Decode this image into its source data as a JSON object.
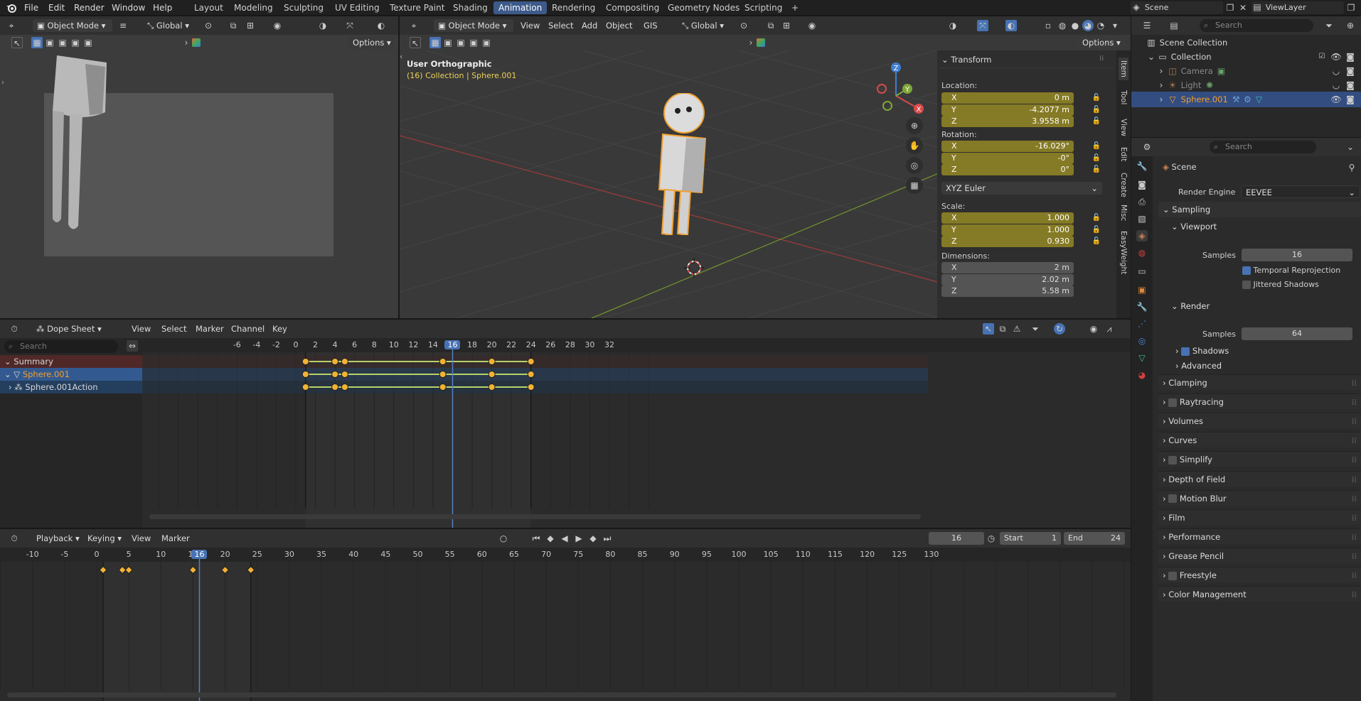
{
  "topmenu": [
    "File",
    "Edit",
    "Render",
    "Window",
    "Help"
  ],
  "workspaces": [
    "Layout",
    "Modeling",
    "Sculpting",
    "UV Editing",
    "Texture Paint",
    "Shading",
    "Animation",
    "Rendering",
    "Compositing",
    "Geometry Nodes",
    "Scripting"
  ],
  "active_workspace": "Animation",
  "scene_name": "Scene",
  "view_layer": "ViewLayer",
  "left_view": {
    "mode": "Object Mode",
    "orientation": "Global",
    "options": "Options"
  },
  "main_view": {
    "mode": "Object Mode",
    "menus": [
      "View",
      "Select",
      "Add",
      "Object",
      "GIS"
    ],
    "orientation": "Global",
    "options": "Options",
    "overlay_title": "User Orthographic",
    "overlay_sub": "(16) Collection | Sphere.001",
    "gizmo": {
      "x": "X",
      "y": "Y",
      "z": "Z"
    }
  },
  "npanel": {
    "tabs": [
      "Item",
      "Tool",
      "View",
      "Edit",
      "Create",
      "Misc",
      "EasyWeight"
    ],
    "transform_title": "Transform",
    "location_label": "Location:",
    "location": [
      {
        "a": "X",
        "v": "0 m"
      },
      {
        "a": "Y",
        "v": "-4.2077 m"
      },
      {
        "a": "Z",
        "v": "3.9558 m"
      }
    ],
    "rotation_label": "Rotation:",
    "rotation": [
      {
        "a": "X",
        "v": "-16.029°"
      },
      {
        "a": "Y",
        "v": "-0°"
      },
      {
        "a": "Z",
        "v": "0°"
      }
    ],
    "rotation_mode": "XYZ Euler",
    "scale_label": "Scale:",
    "scale": [
      {
        "a": "X",
        "v": "1.000"
      },
      {
        "a": "Y",
        "v": "1.000"
      },
      {
        "a": "Z",
        "v": "0.930"
      }
    ],
    "dimensions_label": "Dimensions:",
    "dimensions": [
      {
        "a": "X",
        "v": "2 m"
      },
      {
        "a": "Y",
        "v": "2.02 m"
      },
      {
        "a": "Z",
        "v": "5.58 m"
      }
    ]
  },
  "outliner": {
    "search_placeholder": "Search",
    "items": [
      "Scene Collection",
      "Collection",
      "Camera",
      "Light",
      "Sphere.001"
    ]
  },
  "properties": {
    "search_placeholder": "Search",
    "context": "Scene",
    "render_engine_label": "Render Engine",
    "render_engine": "EEVEE",
    "sampling": "Sampling",
    "viewport": "Viewport",
    "samples_label": "Samples",
    "viewport_samples": "16",
    "temporal_reprojection": "Temporal Reprojection",
    "jittered_shadows": "Jittered Shadows",
    "render": "Render",
    "render_samples": "64",
    "shadows": "Shadows",
    "advanced": "Advanced",
    "sections": [
      "Clamping",
      "Raytracing",
      "Volumes",
      "Curves",
      "Simplify",
      "Depth of Field",
      "Motion Blur",
      "Film",
      "Performance",
      "Grease Pencil",
      "Freestyle",
      "Color Management"
    ]
  },
  "dopesheet": {
    "mode": "Dope Sheet",
    "menus": [
      "View",
      "Select",
      "Marker",
      "Channel",
      "Key"
    ],
    "search_placeholder": "Search",
    "channels": [
      "Summary",
      "Sphere.001",
      "Sphere.001Action"
    ],
    "ticks": [
      "-6",
      "-4",
      "-2",
      "0",
      "2",
      "4",
      "6",
      "8",
      "10",
      "12",
      "14",
      "16",
      "18",
      "20",
      "22",
      "24",
      "26",
      "28",
      "30",
      "32"
    ],
    "current_frame": "16",
    "keyframes": [
      1,
      4,
      5,
      15,
      20,
      24
    ]
  },
  "timeline": {
    "menus": [
      "Playback",
      "Keying",
      "View",
      "Marker"
    ],
    "current_frame": "16",
    "start_label": "Start",
    "start": "1",
    "end_label": "End",
    "end": "24",
    "ticks": [
      "-10",
      "-5",
      "0",
      "5",
      "10",
      "15",
      "20",
      "25",
      "30",
      "35",
      "40",
      "45",
      "50",
      "55",
      "60",
      "65",
      "70",
      "75",
      "80",
      "85",
      "90",
      "95",
      "100",
      "105",
      "110",
      "115",
      "120",
      "125",
      "130"
    ],
    "keyframes": [
      1,
      4,
      5,
      15,
      20,
      24
    ]
  },
  "colors": {
    "accent": "#4772b3",
    "keyframe": "#f2b234",
    "selected_orange": "#f0a030",
    "field_yellow": "#857a25"
  }
}
